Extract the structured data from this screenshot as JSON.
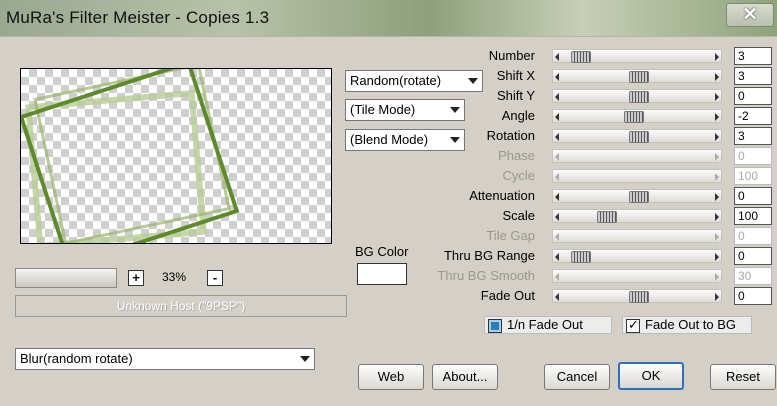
{
  "window": {
    "title": "MuRa's Filter Meister - Copies 1.3",
    "close_glyph": "✕"
  },
  "preview": {
    "zoom": "33%",
    "zoom_in": "+",
    "zoom_out": "-"
  },
  "host_text": "Unknown Host (\"9PSP\")",
  "preset": {
    "selected": "Blur(random rotate)"
  },
  "modes": {
    "copy_mode": "Random(rotate)",
    "tile_mode": "(Tile Mode)",
    "blend_mode": "(Blend Mode)"
  },
  "bg_color": {
    "label": "BG Color",
    "color": "#ffffff"
  },
  "params": [
    {
      "label": "Number",
      "value": "3",
      "level": 0.05,
      "disabled": false
    },
    {
      "label": "Shift X",
      "value": "3",
      "level": 0.5,
      "disabled": false
    },
    {
      "label": "Shift Y",
      "value": "0",
      "level": 0.5,
      "disabled": false
    },
    {
      "label": "Angle",
      "value": "-2",
      "level": 0.46,
      "disabled": false
    },
    {
      "label": "Rotation",
      "value": "3",
      "level": 0.5,
      "disabled": false
    },
    {
      "label": "Phase",
      "value": "0",
      "level": 0,
      "disabled": true
    },
    {
      "label": "Cycle",
      "value": "100",
      "level": 0,
      "disabled": true
    },
    {
      "label": "Attenuation",
      "value": "0",
      "level": 0.5,
      "disabled": false
    },
    {
      "label": "Scale",
      "value": "100",
      "level": 0.25,
      "disabled": false
    },
    {
      "label": "Tile Gap",
      "value": "0",
      "level": 0,
      "disabled": true
    },
    {
      "label": "Thru BG Range",
      "value": "0",
      "level": 0.05,
      "disabled": false
    },
    {
      "label": "Thru BG Smooth",
      "value": "30",
      "level": 0,
      "disabled": true
    },
    {
      "label": "Fade Out",
      "value": "0",
      "level": 0.5,
      "disabled": false
    }
  ],
  "options": {
    "one_n_fade_out": "1/n Fade Out",
    "fade_out_to_bg": "Fade Out to BG"
  },
  "buttons": {
    "web": "Web",
    "about": "About...",
    "cancel": "Cancel",
    "ok": "OK",
    "reset": "Reset"
  }
}
